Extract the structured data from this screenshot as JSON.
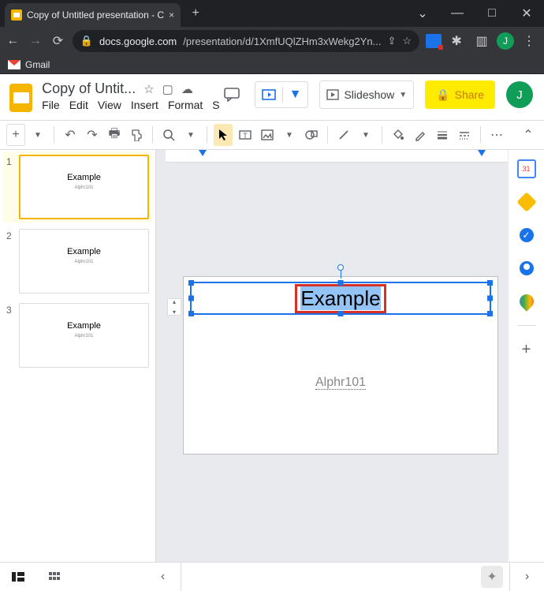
{
  "browser": {
    "tab_title": "Copy of Untitled presentation - C",
    "tab_close": "×",
    "new_tab": "+",
    "win_dropdown": "⌄",
    "win_min": "—",
    "win_max": "□",
    "win_close": "✕",
    "nav_back": "←",
    "nav_fwd": "→",
    "nav_reload": "⟳",
    "lock": "🔒",
    "url_domain": "docs.google.com",
    "url_path": "/presentation/d/1XmfUQlZHm3xWekg2Yn...",
    "bookmark_label": "Gmail"
  },
  "doc": {
    "title": "Copy of Untit...",
    "star": "☆",
    "move": "▢",
    "cloud": "☁",
    "menus": [
      "File",
      "Edit",
      "View",
      "Insert",
      "Format",
      "S"
    ],
    "comments": "▭",
    "present_icon": "▣",
    "slideshow": "Slideshow",
    "share": "Share",
    "avatar": "J"
  },
  "toolbar": {
    "plus": "+",
    "dd": "▼",
    "undo": "↶",
    "redo": "↷",
    "print": "🖶",
    "paint": "⌄",
    "zoom": "🔍",
    "cursor": "▲",
    "textbox": "T",
    "image": "▭",
    "shape": "◯",
    "line": "╲",
    "fill": "◆",
    "border": "✎",
    "weight": "≡",
    "dash": "≣",
    "more": "⋯",
    "expand": "⌃"
  },
  "slides": {
    "items": [
      {
        "num": "1",
        "title": "Example",
        "sub": "Alphr101"
      },
      {
        "num": "2",
        "title": "Example",
        "sub": "Alphr101"
      },
      {
        "num": "3",
        "title": "Example",
        "sub": "Alphr101"
      }
    ]
  },
  "canvas": {
    "title_text": "Example",
    "subtitle_text": "Alphr101",
    "guide": "≡"
  },
  "sidepanel": {
    "plus": "+"
  },
  "bottom": {
    "filmstrip": "▤",
    "grid": "▦",
    "collapse": "‹",
    "explore": "✦",
    "panel_toggle": "›"
  }
}
